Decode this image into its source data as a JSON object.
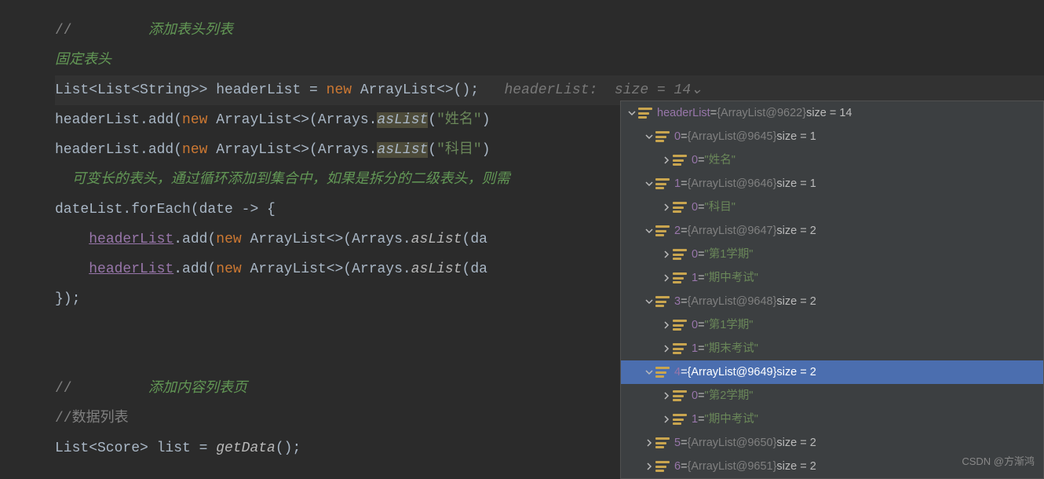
{
  "code": {
    "c1_slash": "//         ",
    "c1_text": "添加表头列表",
    "c2_text": "固定表头",
    "l3_a": "List<List<String>> headerList = ",
    "l3_new": "new",
    "l3_b": " ArrayList<>();",
    "l3_hint_name": "   headerList:",
    "l3_hint_size": "  size = 14",
    "l4_a": "headerList.add(",
    "l4_new": "new",
    "l4_b": " ArrayList<>(Arrays.",
    "l4_m": "asList",
    "l4_c": "(",
    "l4_s": "\"姓名\"",
    "l4_d": ")",
    "l5_s": "\"科目\"",
    "c6_text": "可变长的表头，通过循环添加到集合中，如果是拆分的二级表头，则需",
    "l7_a": "dateList.forEach(date -> {",
    "l8_a": ".add(",
    "l8_new": "new",
    "l8_b": " ArrayList<>(Arrays.",
    "l8_m": "asList",
    "l8_c": "(da",
    "headerList_var": "headerList",
    "l10": "});",
    "c11_slash": "//         ",
    "c11_text": "添加内容列表页",
    "c12_text": "//数据列表",
    "l13_a": "List<Score> list = ",
    "l13_m": "getData",
    "l13_b": "();"
  },
  "debug": {
    "root": "headerList",
    "root_type": "{ArrayList@9622}",
    "root_size": "size = 14",
    "items": [
      {
        "idx": "0",
        "type": "{ArrayList@9645}",
        "size": "size = 1",
        "children": [
          {
            "idx": "0",
            "val": "\"姓名\""
          }
        ]
      },
      {
        "idx": "1",
        "type": "{ArrayList@9646}",
        "size": "size = 1",
        "children": [
          {
            "idx": "0",
            "val": "\"科目\""
          }
        ]
      },
      {
        "idx": "2",
        "type": "{ArrayList@9647}",
        "size": "size = 2",
        "children": [
          {
            "idx": "0",
            "val": "\"第1学期\""
          },
          {
            "idx": "1",
            "val": "\"期中考试\""
          }
        ]
      },
      {
        "idx": "3",
        "type": "{ArrayList@9648}",
        "size": "size = 2",
        "children": [
          {
            "idx": "0",
            "val": "\"第1学期\""
          },
          {
            "idx": "1",
            "val": "\"期末考试\""
          }
        ]
      },
      {
        "idx": "4",
        "type": "{ArrayList@9649}",
        "size": "size = 2",
        "selected": true,
        "children": [
          {
            "idx": "0",
            "val": "\"第2学期\""
          },
          {
            "idx": "1",
            "val": "\"期中考试\""
          }
        ]
      },
      {
        "idx": "5",
        "type": "{ArrayList@9650}",
        "size": "size = 2",
        "collapsed": true
      },
      {
        "idx": "6",
        "type": "{ArrayList@9651}",
        "size": "size = 2",
        "collapsed": true
      }
    ]
  },
  "watermark": "CSDN @方渐鸿"
}
